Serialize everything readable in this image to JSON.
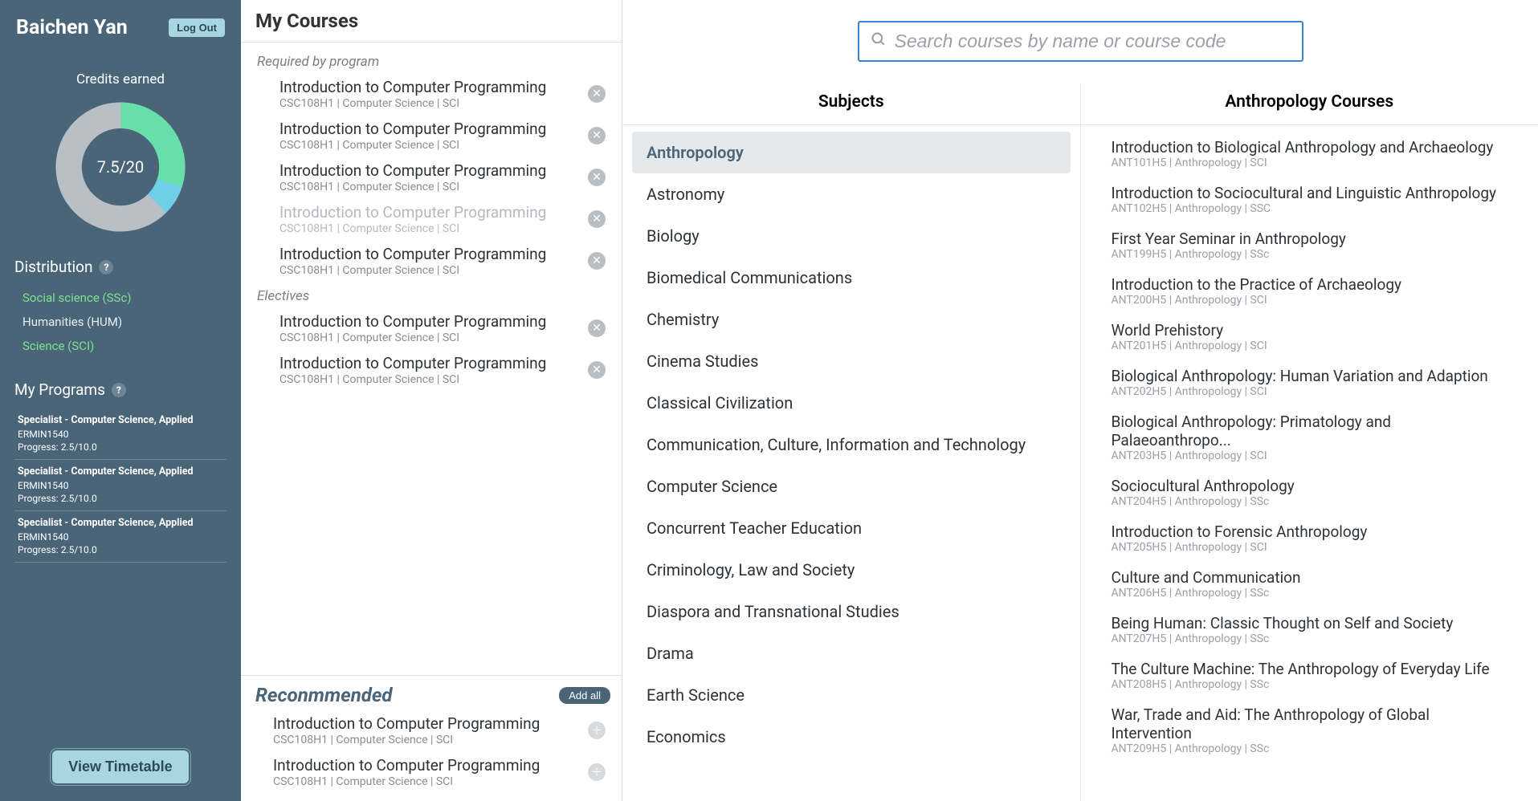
{
  "sidebar": {
    "user_name": "Baichen Yan",
    "logout_label": "Log Out",
    "credits_label": "Credits earned",
    "credits_text": "7.5/20",
    "distribution_heading": "Distribution",
    "distribution": [
      {
        "label": "Social science (SSc)",
        "cls": "dist-green"
      },
      {
        "label": "Humanities (HUM)",
        "cls": "dist-white"
      },
      {
        "label": "Science (SCI)",
        "cls": "dist-green"
      }
    ],
    "programs_heading": "My Programs",
    "programs": [
      {
        "title": "Specialist - Computer Science, Applied",
        "code": "ERMIN1540",
        "progress": "Progress: 2.5/10.0"
      },
      {
        "title": "Specialist - Computer Science, Applied",
        "code": "ERMIN1540",
        "progress": "Progress: 2.5/10.0"
      },
      {
        "title": "Specialist - Computer Science, Applied",
        "code": "ERMIN1540",
        "progress": "Progress: 2.5/10.0"
      }
    ],
    "timetable_label": "View Timetable"
  },
  "mycourses": {
    "heading": "My Courses",
    "groups": [
      {
        "label": "Required by program",
        "courses": [
          {
            "title": "Introduction to Computer Programming",
            "meta": "CSC108H1 | Computer Science | SCI",
            "disabled": false
          },
          {
            "title": "Introduction to Computer Programming",
            "meta": "CSC108H1 | Computer Science | SCI",
            "disabled": false
          },
          {
            "title": "Introduction to Computer Programming",
            "meta": "CSC108H1 | Computer Science | SCI",
            "disabled": false
          },
          {
            "title": "Introduction to Computer Programming",
            "meta": "CSC108H1 | Computer Science | SCI",
            "disabled": true
          },
          {
            "title": "Introduction to Computer Programming",
            "meta": "CSC108H1 | Computer Science | SCI",
            "disabled": false
          }
        ]
      },
      {
        "label": "Electives",
        "courses": [
          {
            "title": "Introduction to Computer Programming",
            "meta": "CSC108H1 | Computer Science | SCI",
            "disabled": false
          },
          {
            "title": "Introduction to Computer Programming",
            "meta": "CSC108H1 | Computer Science | SCI",
            "disabled": false
          }
        ]
      }
    ],
    "recommended_heading": "Reconmmended",
    "add_all_label": "Add all",
    "recommended": [
      {
        "title": "Introduction to Computer Programming",
        "meta": "CSC108H1 | Computer Science | SCI"
      },
      {
        "title": "Introduction to Computer Programming",
        "meta": "CSC108H1 | Computer Science | SCI"
      }
    ]
  },
  "search": {
    "placeholder": "Search courses by name or course code"
  },
  "subjects": {
    "heading": "Subjects",
    "items": [
      "Anthropology",
      "Astronomy",
      "Biology",
      "Biomedical Communications",
      "Chemistry",
      "Cinema Studies",
      "Classical Civilization",
      "Communication, Culture, Information and Technology",
      "Computer Science",
      "Concurrent Teacher Education",
      "Criminology, Law and Society",
      "Diaspora and Transnational Studies",
      "Drama",
      "Earth Science",
      "Economics"
    ],
    "selected_index": 0
  },
  "catalog": {
    "heading": "Anthropology Courses",
    "items": [
      {
        "title": "Introduction to Biological Anthropology and Archaeology",
        "meta": "ANT101H5 | Anthropology | SCI"
      },
      {
        "title": "Introduction to Sociocultural and Linguistic Anthropology",
        "meta": "ANT102H5 | Anthropology | SSC"
      },
      {
        "title": "First Year Seminar in Anthropology",
        "meta": "ANT199H5 | Anthropology | SSc"
      },
      {
        "title": "Introduction to the Practice of Archaeology",
        "meta": "ANT200H5 | Anthropology | SCI"
      },
      {
        "title": "World Prehistory",
        "meta": "ANT201H5 | Anthropology | SCI"
      },
      {
        "title": "Biological Anthropology: Human Variation and Adaption",
        "meta": "ANT202H5 | Anthropology | SCI"
      },
      {
        "title": "Biological Anthropology: Primatology and Palaeoanthropo...",
        "meta": "ANT203H5 | Anthropology | SCI"
      },
      {
        "title": "Sociocultural Anthropology",
        "meta": "ANT204H5 | Anthropology | SSc"
      },
      {
        "title": "Introduction to Forensic Anthropology",
        "meta": "ANT205H5 | Anthropology | SCI"
      },
      {
        "title": "Culture and Communication",
        "meta": "ANT206H5 | Anthropology | SSc"
      },
      {
        "title": "Being Human: Classic Thought on Self and Society",
        "meta": "ANT207H5 | Anthropology | SSc"
      },
      {
        "title": "The Culture Machine: The Anthropology of Everyday Life",
        "meta": "ANT208H5 | Anthropology | SSc"
      },
      {
        "title": "War, Trade and Aid: The Anthropology of Global Intervention",
        "meta": "ANT209H5 | Anthropology | SSc"
      }
    ]
  }
}
